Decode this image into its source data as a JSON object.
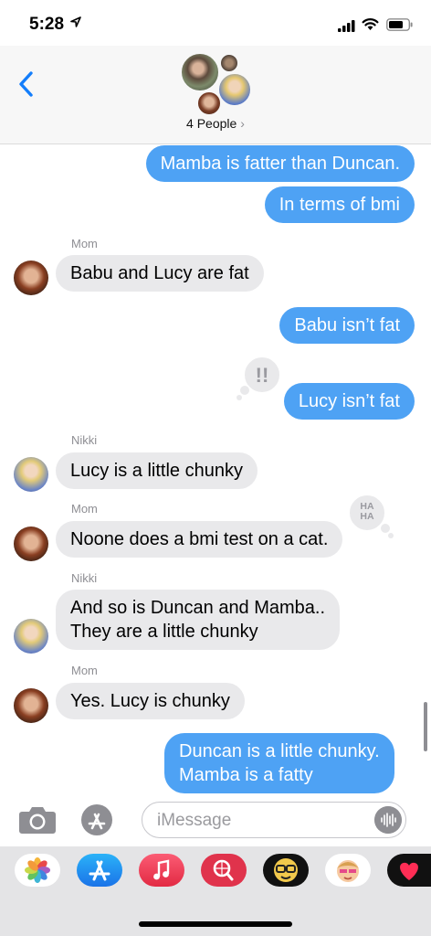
{
  "status_bar": {
    "time": "5:28"
  },
  "header": {
    "people_label": "4 People",
    "chevron": "›"
  },
  "messages": [
    {
      "text": "Mamba is fatter than Duncan."
    },
    {
      "text": "In terms of bmi"
    },
    {
      "sender": "Mom",
      "text": "Babu and Lucy are fat"
    },
    {
      "text": "Babu isn’t fat"
    },
    {
      "text": "Lucy isn’t fat",
      "tapback": "!!"
    },
    {
      "sender": "Nikki",
      "text": "Lucy is a little chunky"
    },
    {
      "sender": "Mom",
      "text": "Noone does a bmi test on a cat.",
      "tapback": "HA HA"
    },
    {
      "sender": "Nikki",
      "line1": "And so is Duncan and Mamba..",
      "line2": "They are a little chunky"
    },
    {
      "sender": "Mom",
      "text": "Yes. Lucy is chunky"
    },
    {
      "line1": "Duncan is a little chunky.",
      "line2": "Mamba is a fatty"
    }
  ],
  "compose": {
    "placeholder": "iMessage"
  },
  "icons": [
    "camera-icon",
    "app-store-icon",
    "photos-icon",
    "music-icon",
    "search-images-icon",
    "memoji-icon",
    "digital-touch-icon"
  ],
  "colors": {
    "outgoing": "#4ea2f4",
    "incoming": "#e9e9eb",
    "accent": "#147efb"
  }
}
